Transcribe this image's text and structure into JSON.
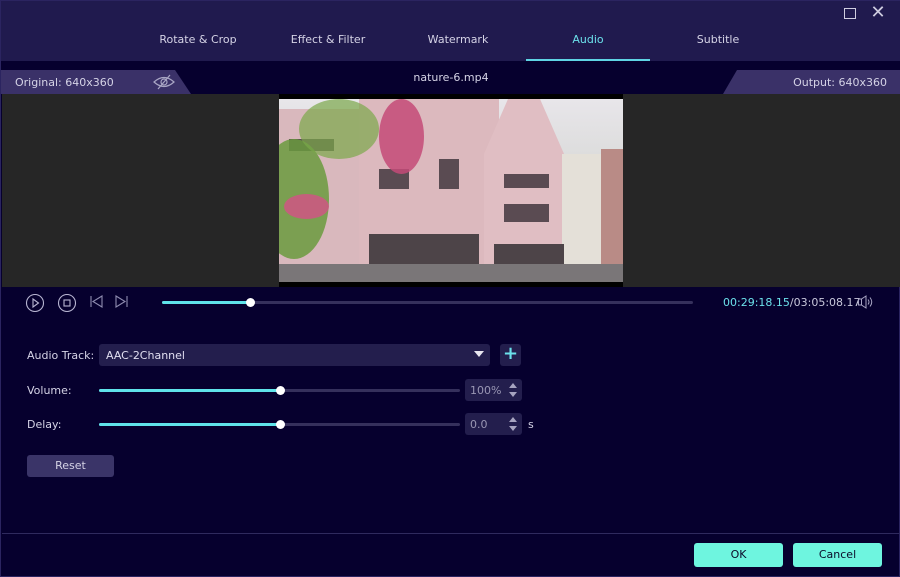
{
  "window": {
    "maximize_icon": "maximize-icon",
    "close_icon": "close-icon",
    "close_glyph": "✕"
  },
  "tabs": [
    {
      "label": "Rotate & Crop",
      "active": false
    },
    {
      "label": "Effect & Filter",
      "active": false
    },
    {
      "label": "Watermark",
      "active": false
    },
    {
      "label": "Audio",
      "active": true
    },
    {
      "label": "Subtitle",
      "active": false
    }
  ],
  "file": {
    "original_label": "Original: 640x360",
    "output_label": "Output: 640x360",
    "filename": "nature-6.mp4",
    "toggle_icon": "eye-slash-icon"
  },
  "playback": {
    "current_time": "00:29:18.15",
    "separator": "/",
    "total_time": "03:05:08.17",
    "progress": 0.165,
    "icons": [
      "play-icon",
      "stop-icon",
      "previous-frame-icon",
      "next-frame-icon",
      "volume-icon"
    ]
  },
  "audio": {
    "track_label": "Audio Track:",
    "track_value": "AAC-2Channel",
    "add_track_glyph": "+",
    "volume_label": "Volume:",
    "volume_value": "100%",
    "volume_level": 0.5,
    "delay_label": "Delay:",
    "delay_value": "0.0",
    "delay_level": 0.5,
    "delay_unit": "s",
    "reset_label": "Reset"
  },
  "footer": {
    "ok_label": "OK",
    "cancel_label": "Cancel"
  },
  "colors": {
    "accent": "#6be0ea",
    "button": "#6ef5df",
    "background": "#06002e",
    "header": "#201a4e"
  }
}
